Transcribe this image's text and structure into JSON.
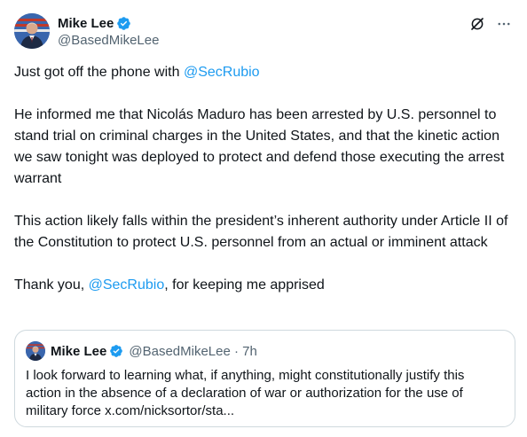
{
  "author": {
    "display_name": "Mike Lee",
    "handle": "@BasedMikeLee",
    "verified": true
  },
  "icons": {
    "verified": "verified-badge-icon",
    "grok": "grok-icon",
    "more": "more-icon"
  },
  "colors": {
    "link": "#1d9bf0",
    "text": "#0f1419",
    "muted": "#536471",
    "border": "#cfd9de",
    "verified": "#1d9bf0"
  },
  "post": {
    "p1_text": "Just got off the phone with ",
    "p1_mention": "@SecRubio",
    "p2_text": "He informed me that Nicolás Maduro has been arrested by U.S. personnel to stand trial on criminal charges in the United States, and that the kinetic action we saw tonight was deployed to protect and defend those executing the arrest warrant",
    "p3_text": "This action likely falls within the president’s inherent authority under Article II of the Constitution to protect U.S. personnel from an actual or imminent attack",
    "p4_before": "Thank you, ",
    "p4_mention": "@SecRubio",
    "p4_after": ", for keeping me apprised"
  },
  "quote": {
    "display_name": "Mike Lee",
    "meta": "@BasedMikeLee · 7h",
    "text": "I look forward to learning what, if anything, might constitutionally justify this action in the absence of a declaration of war or authorization for the use of military force x.com/nicksortor/sta..."
  }
}
